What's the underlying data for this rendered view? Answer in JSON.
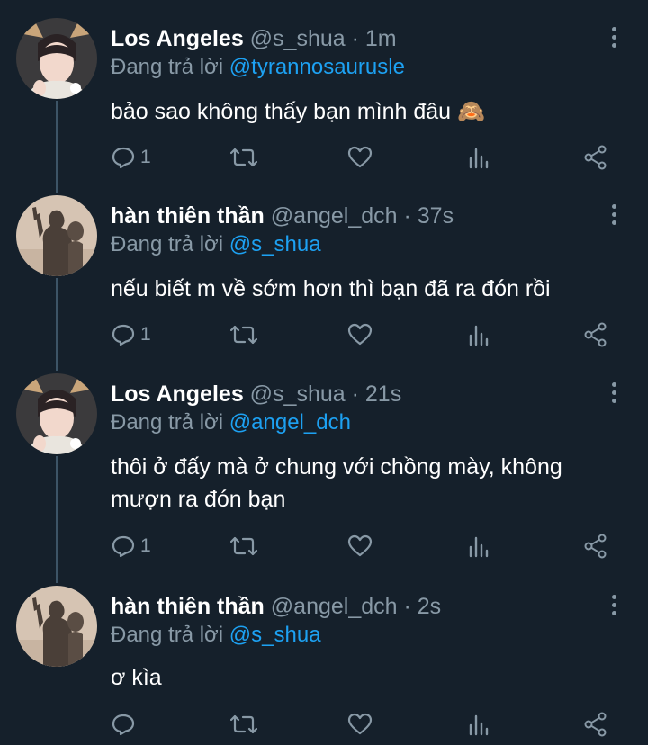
{
  "replying_prefix": "Đang trả lời",
  "colors": {
    "background": "#15202b",
    "text_primary": "#ffffff",
    "text_secondary": "#8899a6",
    "accent": "#1da1f2",
    "thread_line": "#3d5466"
  },
  "tweets": [
    {
      "name": "Los Angeles",
      "handle": "@s_shua",
      "separator": "·",
      "time": "1m",
      "replying_to": "@tyrannosaurusle",
      "text": "bảo sao không thấy bạn mình đâu 🙈",
      "reply_count": "1",
      "avatar": "avatar-deer-ears"
    },
    {
      "name": "hàn thiên thần",
      "handle": "@angel_dch",
      "separator": "·",
      "time": "37s",
      "replying_to": "@s_shua",
      "text": "nếu biết m về sớm hơn thì bạn đã ra đón rồi",
      "reply_count": "1",
      "avatar": "avatar-shadow-silhouette"
    },
    {
      "name": "Los Angeles",
      "handle": "@s_shua",
      "separator": "·",
      "time": "21s",
      "replying_to": "@angel_dch",
      "text": "thôi ở đấy mà ở chung với chồng mày, không mượn ra đón bạn",
      "reply_count": "1",
      "avatar": "avatar-deer-ears"
    },
    {
      "name": "hàn thiên thần",
      "handle": "@angel_dch",
      "separator": "·",
      "time": "2s",
      "replying_to": "@s_shua",
      "text": "ơ kìa",
      "reply_count": "",
      "avatar": "avatar-shadow-silhouette"
    }
  ]
}
